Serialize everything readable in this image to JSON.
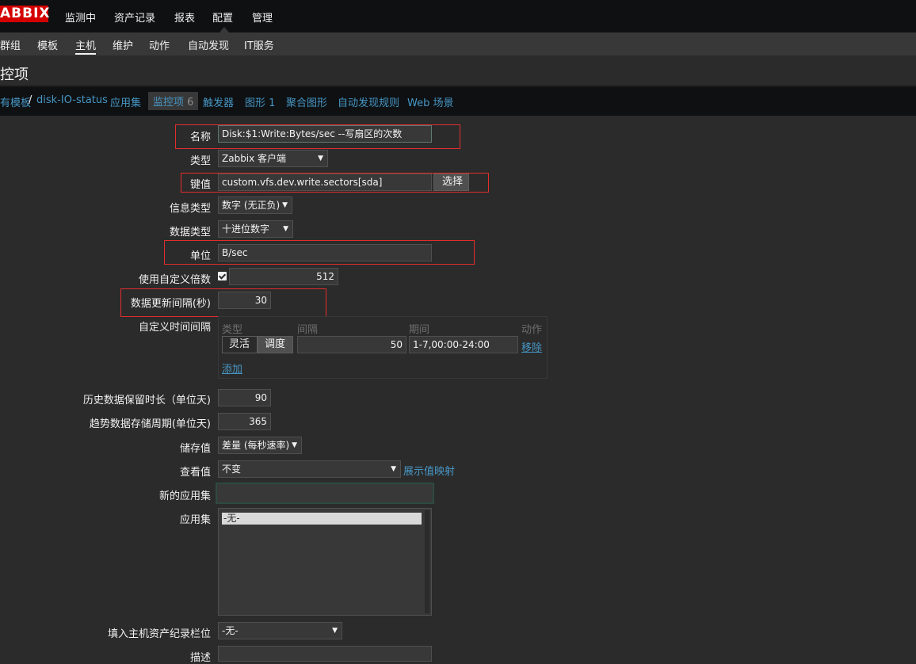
{
  "brand": {
    "logo": "ABBIX"
  },
  "topnav": [
    {
      "label": "监测中"
    },
    {
      "label": "资产记录"
    },
    {
      "label": "报表"
    },
    {
      "label": "配置"
    },
    {
      "label": "管理"
    }
  ],
  "subnav": [
    {
      "label": "群组"
    },
    {
      "label": "模板"
    },
    {
      "label": "主机"
    },
    {
      "label": "维护"
    },
    {
      "label": "动作"
    },
    {
      "label": "自动发现"
    },
    {
      "label": "IT服务"
    }
  ],
  "page": {
    "title": "控项"
  },
  "tabs": {
    "breadcrumb_all": "有模板",
    "breadcrumb_sep": "/",
    "template": "disk-IO-status",
    "applications": "应用集",
    "items": "监控项",
    "items_count": "6",
    "triggers": "触发器",
    "graphs": "图形",
    "graphs_count": "1",
    "screens": "聚合图形",
    "discovery": "自动发现规则",
    "web": "Web 场景"
  },
  "form": {
    "name_label": "名称",
    "name_value": "Disk:$1:Write:Bytes/sec --写扇区的次数",
    "type_label": "类型",
    "type_value": "Zabbix 客户端",
    "key_label": "键值",
    "key_value": "custom.vfs.dev.write.sectors[sda]",
    "key_select_btn": "选择",
    "info_type_label": "信息类型",
    "info_type_value": "数字 (无正负)",
    "data_type_label": "数据类型",
    "data_type_value": "十进位数字",
    "units_label": "单位",
    "units_value": "B/sec",
    "multiplier_label": "使用自定义倍数",
    "multiplier_value": "512",
    "interval_label": "数据更新间隔(秒)",
    "interval_value": "30",
    "custom_intervals_label": "自定义时间间隔",
    "ci_header_type": "类型",
    "ci_header_interval": "间隔",
    "ci_header_period": "期间",
    "ci_header_action": "动作",
    "ci_flexible": "灵活",
    "ci_scheduling": "调度",
    "ci_interval_value": "50",
    "ci_period_value": "1-7,00:00-24:00",
    "ci_remove": "移除",
    "ci_add": "添加",
    "history_label": "历史数据保留时长（单位天)",
    "history_value": "90",
    "trends_label": "趋势数据存储周期(单位天)",
    "trends_value": "365",
    "store_label": "储存值",
    "store_value": "差量 (每秒速率)",
    "show_value_label": "查看值",
    "show_value_value": "不变",
    "show_value_link": "展示值映射",
    "new_app_label": "新的应用集",
    "new_app_value": "",
    "apps_label": "应用集",
    "apps_option": "-无-",
    "inventory_label": "填入主机资产纪录栏位",
    "inventory_value": "-无-",
    "desc_label": "描述"
  }
}
